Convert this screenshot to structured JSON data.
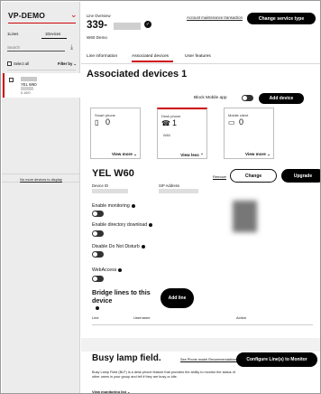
{
  "sidebar": {
    "account": "VP-DEMO",
    "tabs": [
      "1Lines",
      "1Devices"
    ],
    "search_placeholder": "Search",
    "select_all": "Select all",
    "filter_by": "Filter by",
    "items": [
      {
        "name": "YEL W60",
        "sub": "0.19/0"
      }
    ],
    "footer": "No more devices to display"
  },
  "header": {
    "line_overview": "Line Overview",
    "number": "339-",
    "name": "W60 Demo",
    "account_maintenance": "Account maintenance transaction",
    "change_service_type": "Change service type"
  },
  "tabs": [
    "Line information",
    "Associated devices",
    "User features"
  ],
  "associated": {
    "title": "Associated devices 1",
    "block_mobile": "Block Mobile app",
    "add_device": "Add device",
    "cards": [
      {
        "label": "Smart phone",
        "count": "0",
        "sub": "",
        "view": "View more"
      },
      {
        "label": "Desk phone",
        "count": "1",
        "sub": "W60",
        "view": "View less"
      },
      {
        "label": "Mobile client",
        "count": "0",
        "sub": "",
        "view": "View more"
      }
    ]
  },
  "device": {
    "name": "YEL W60",
    "remove": "Remove",
    "change": "Change",
    "upgrade": "Upgrade",
    "device_id_label": "Device ID",
    "sip_address_label": "SIP Address",
    "settings": [
      "Enable monitoring",
      "Enable directory download",
      "Disable Do Not Disturb",
      "WebAccess"
    ]
  },
  "bridge": {
    "title": "Bridge lines to this device",
    "add_line": "Add line",
    "columns": [
      "Line",
      "Username",
      "Action"
    ]
  },
  "blf": {
    "title": "Busy lamp field.",
    "see_link": "See Phone model Recommendations",
    "configure": "Configure Line(s) to Monitor",
    "desc": "Busy Lamp Field (BLF) is a desk phone feature that provides the ability to monitor the status of other users in your group and tell if they are busy or idle.",
    "view_monitoring": "View monitoring list"
  }
}
